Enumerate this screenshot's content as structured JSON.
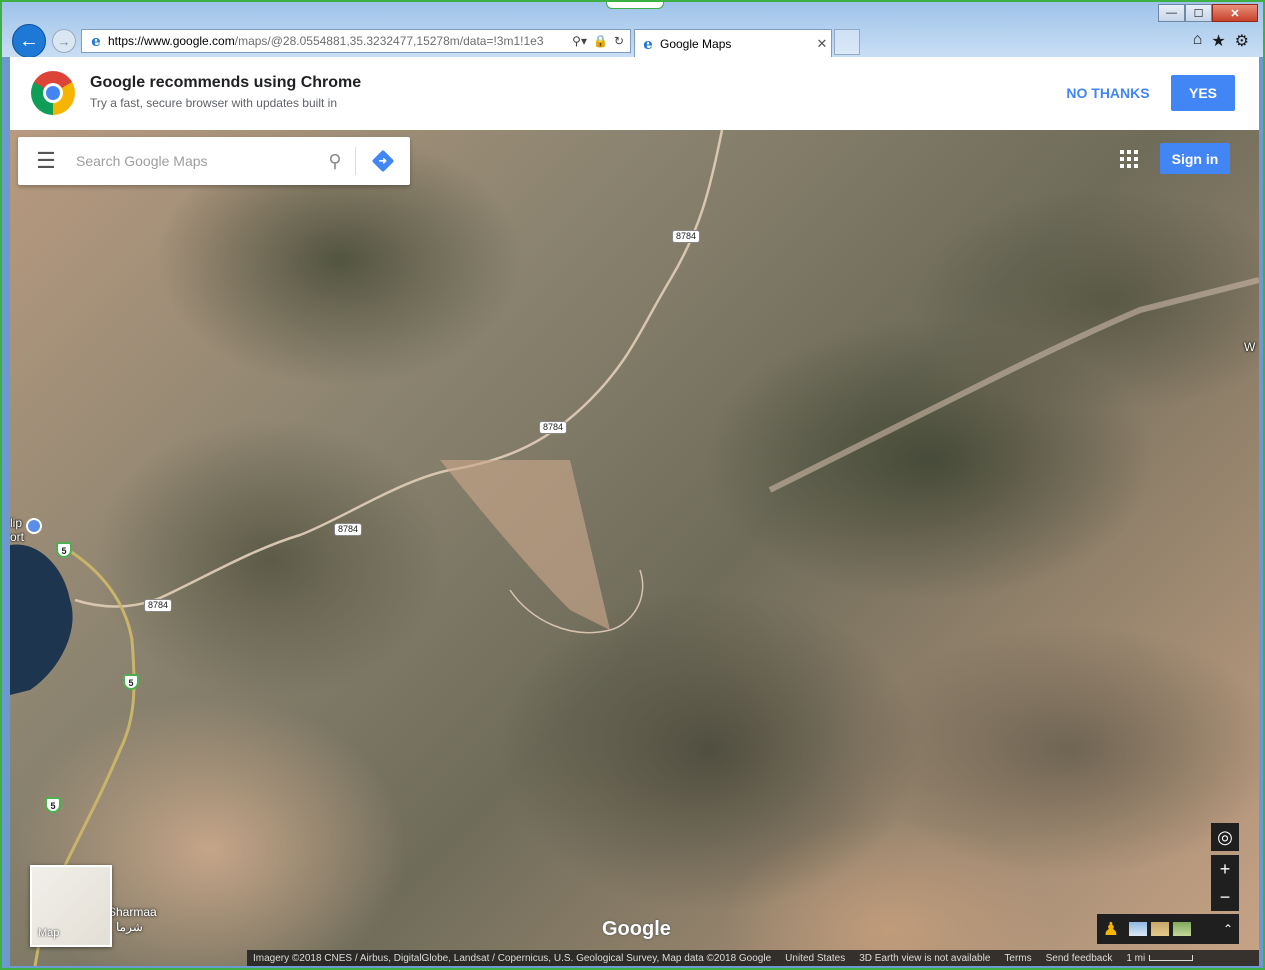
{
  "browser": {
    "address": {
      "url_scheme": "https://www.",
      "url_domain": "google.com",
      "url_rest": "/maps/@28.0554881,35.3232477,15278m/data=!3m1!1e3"
    },
    "tab": {
      "title": "Google Maps"
    },
    "window_controls": {
      "minimize": "—",
      "maximize": "☐",
      "close": "✕"
    }
  },
  "banner": {
    "title": "Google recommends using Chrome",
    "subtitle": "Try a fast, secure browser with updates built in",
    "no_thanks": "NO THANKS",
    "yes": "YES"
  },
  "map": {
    "search": {
      "placeholder": "Search Google Maps"
    },
    "signin": "Sign in",
    "road_labels": [
      "8784",
      "8784",
      "8784",
      "8784"
    ],
    "highway_shields": [
      "5",
      "5",
      "5"
    ],
    "place_partial_left": "lip",
    "place_partial_left2": "ort",
    "place_partial_right": "W",
    "place_label_latin": "Sharmaa",
    "place_label_arabic": "شرما",
    "minimap_label": "Map",
    "logo": "Google",
    "controls": {
      "locate": "◎",
      "zoom_in": "+",
      "zoom_out": "−"
    },
    "footer": {
      "imagery": "Imagery ©2018 CNES / Airbus, DigitalGlobe, Landsat / Copernicus, U.S. Geological Survey, Map data ©2018 Google",
      "region": "United States",
      "earth_note": "3D Earth view is not available",
      "terms": "Terms",
      "feedback": "Send feedback",
      "scale": "1 mi"
    }
  },
  "colors": {
    "accent": "#4285f4",
    "frame": "#3cb043"
  }
}
